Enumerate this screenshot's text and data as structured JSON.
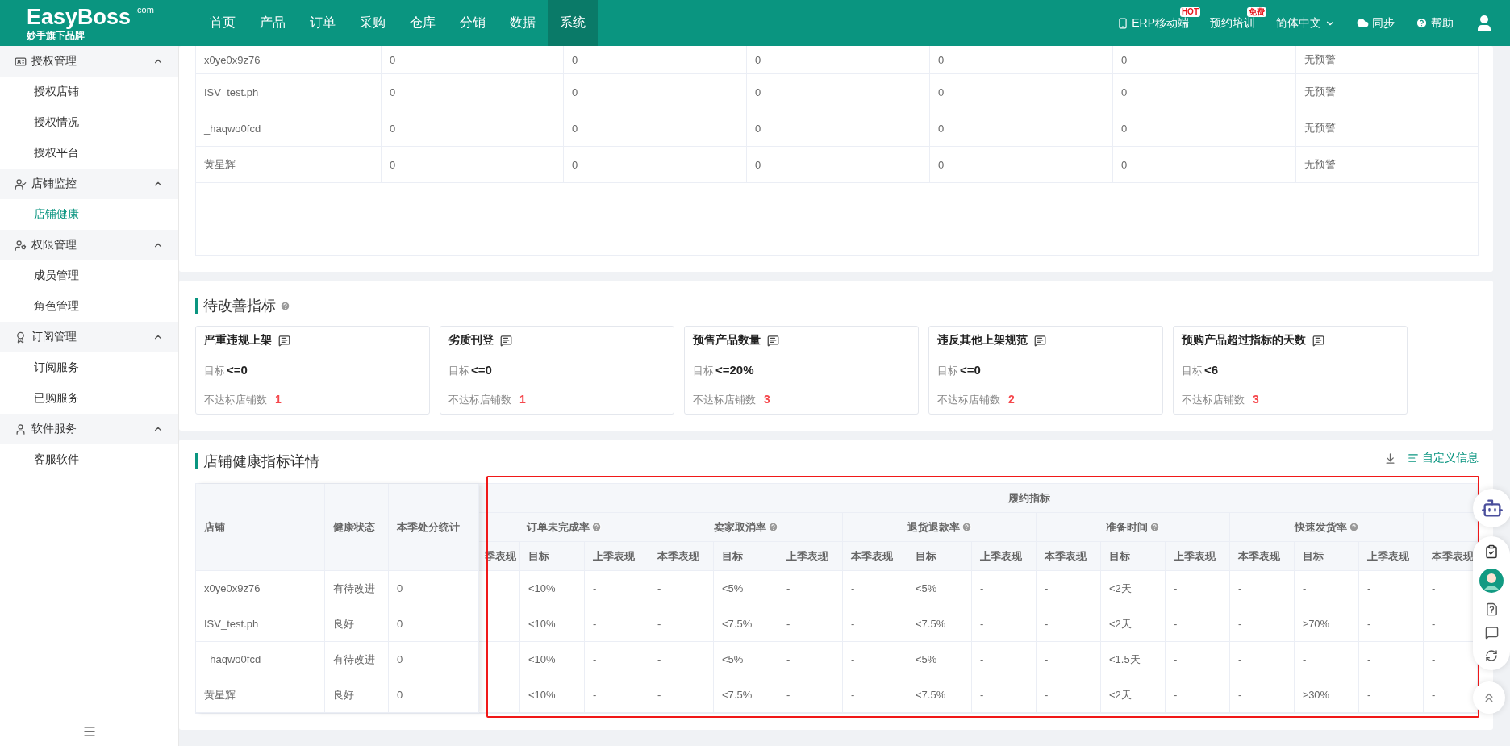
{
  "header": {
    "logo": "EasyBoss",
    "logo_suffix": ".com",
    "tagline": "妙手旗下品牌",
    "nav": [
      {
        "label": "首页",
        "selected": false
      },
      {
        "label": "产品",
        "selected": false
      },
      {
        "label": "订单",
        "selected": false
      },
      {
        "label": "采购",
        "selected": false
      },
      {
        "label": "仓库",
        "selected": false
      },
      {
        "label": "分销",
        "selected": false
      },
      {
        "label": "数据",
        "selected": false
      },
      {
        "label": "系统",
        "selected": true
      }
    ],
    "links": [
      {
        "kind": "mobile",
        "label": "ERP移动端",
        "badge": "HOT"
      },
      {
        "kind": "training",
        "label": "预约培训",
        "badge": "免费"
      },
      {
        "kind": "language",
        "label": "简体中文"
      },
      {
        "kind": "sync",
        "label": "同步"
      },
      {
        "kind": "help",
        "label": "帮助"
      },
      {
        "kind": "user"
      }
    ]
  },
  "sidebar": {
    "groups": [
      {
        "kind": "auth",
        "label": "授权管理",
        "expanded": true,
        "items": [
          {
            "label": "授权店铺",
            "selected": false
          },
          {
            "label": "授权情况",
            "selected": false
          },
          {
            "label": "授权平台",
            "selected": false
          }
        ]
      },
      {
        "kind": "monitor",
        "label": "店铺监控",
        "expanded": true,
        "items": [
          {
            "label": "店铺健康",
            "selected": true
          }
        ]
      },
      {
        "kind": "permission",
        "label": "权限管理",
        "expanded": true,
        "items": [
          {
            "label": "成员管理",
            "selected": false
          },
          {
            "label": "角色管理",
            "selected": false
          }
        ]
      },
      {
        "kind": "subscription",
        "label": "订阅管理",
        "expanded": true,
        "items": [
          {
            "label": "订阅服务",
            "selected": false
          },
          {
            "label": "已购服务",
            "selected": false
          }
        ]
      },
      {
        "kind": "software",
        "label": "软件服务",
        "expanded": true,
        "items": [
          {
            "label": "客服软件",
            "selected": false
          }
        ]
      }
    ]
  },
  "top_table": {
    "rows": [
      {
        "cells": [
          "x0ye0x9z76",
          "0",
          "0",
          "0",
          "0",
          "0",
          "无预警"
        ]
      },
      {
        "cells": [
          "ISV_test.ph",
          "0",
          "0",
          "0",
          "0",
          "0",
          "无预警"
        ]
      },
      {
        "cells": [
          "_haqwo0fcd",
          "0",
          "0",
          "0",
          "0",
          "0",
          "无预警"
        ]
      },
      {
        "cells": [
          "黄星辉",
          "0",
          "0",
          "0",
          "0",
          "0",
          "无预警"
        ]
      }
    ]
  },
  "improvement": {
    "title": "待改善指标",
    "cards": [
      {
        "title": "严重违规上架",
        "target_label": "目标",
        "target_value": "<=0",
        "fail_label": "不达标店铺数",
        "fail_count": "1"
      },
      {
        "title": "劣质刊登",
        "target_label": "目标",
        "target_value": "<=0",
        "fail_label": "不达标店铺数",
        "fail_count": "1"
      },
      {
        "title": "预售产品数量",
        "target_label": "目标",
        "target_value": "<=20%",
        "fail_label": "不达标店铺数",
        "fail_count": "3"
      },
      {
        "title": "违反其他上架规范",
        "target_label": "目标",
        "target_value": "<=0",
        "fail_label": "不达标店铺数",
        "fail_count": "2"
      },
      {
        "title": "预购产品超过指标的天数",
        "target_label": "目标",
        "target_value": "<6",
        "fail_label": "不达标店铺数",
        "fail_count": "3"
      }
    ]
  },
  "details": {
    "title": "店铺健康指标详情",
    "action": "自定义信息",
    "fixed_columns": [
      "店铺",
      "健康状态",
      "本季处分统计"
    ],
    "group_title": "履约指标",
    "metrics": [
      "订单未完成率",
      "卖家取消率",
      "退货退款率",
      "准备时间",
      "快速发货率"
    ],
    "sub_columns": [
      "季表现",
      "目标",
      "上季表现",
      "本季表现",
      "目标",
      "上季表现",
      "本季表现",
      "目标",
      "上季表现",
      "本季表现",
      "目标",
      "上季表现",
      "本季表现",
      "目标",
      "上季表现",
      "本季表现"
    ],
    "rows": [
      {
        "store": "x0ye0x9z76",
        "status": "有待改进",
        "penalty": "0",
        "cells": [
          "<10%",
          "-",
          "-",
          "<5%",
          "-",
          "-",
          "<5%",
          "-",
          "-",
          "<2天",
          "-",
          "-",
          "-",
          "-",
          "-"
        ]
      },
      {
        "store": "ISV_test.ph",
        "status": "良好",
        "penalty": "0",
        "cells": [
          "<10%",
          "-",
          "-",
          "<7.5%",
          "-",
          "-",
          "<7.5%",
          "-",
          "-",
          "<2天",
          "-",
          "-",
          "≥70%",
          "-",
          "-"
        ]
      },
      {
        "store": "_haqwo0fcd",
        "status": "有待改进",
        "penalty": "0",
        "cells": [
          "<10%",
          "-",
          "-",
          "<5%",
          "-",
          "-",
          "<5%",
          "-",
          "-",
          "<1.5天",
          "-",
          "-",
          "-",
          "-",
          "-"
        ]
      },
      {
        "store": "黄星辉",
        "status": "良好",
        "penalty": "0",
        "cells": [
          "<10%",
          "-",
          "-",
          "<7.5%",
          "-",
          "-",
          "<7.5%",
          "-",
          "-",
          "<2天",
          "-",
          "-",
          "≥30%",
          "-",
          "-"
        ]
      }
    ]
  }
}
